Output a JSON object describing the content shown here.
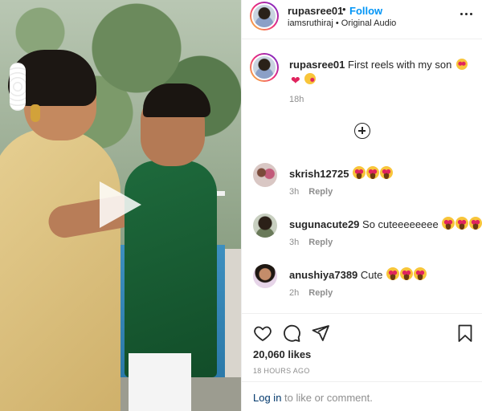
{
  "post": {
    "username": "rupasree01",
    "follow_label": "Follow",
    "separator": "•",
    "subtitle": "iamsruthiraj • Original Audio",
    "caption_text": "First reels with my son",
    "caption_time": "18h"
  },
  "comments": [
    {
      "username": "skrish12725",
      "text": "",
      "time": "3h",
      "reply_label": "Reply",
      "emoji_count": 3
    },
    {
      "username": "sugunacute29",
      "text": "So cuteeeeeeee",
      "time": "3h",
      "reply_label": "Reply",
      "emoji_count": 3
    },
    {
      "username": "anushiya7389",
      "text": "Cute",
      "time": "2h",
      "reply_label": "Reply",
      "emoji_count": 3
    }
  ],
  "footer": {
    "likes": "20,060 likes",
    "date": "18 HOURS AGO",
    "login_link": "Log in",
    "login_rest": " to like or comment."
  },
  "icons": {
    "like": "heart-outline-icon",
    "comment": "comment-bubble-icon",
    "share": "paper-plane-icon",
    "save": "bookmark-icon",
    "more": "more-dots-icon",
    "load_more": "add-circle-icon",
    "play": "play-icon"
  },
  "colors": {
    "follow_blue": "#0095f6",
    "link_dark_blue": "#00376b",
    "muted_gray": "#8e8e8e",
    "text_dark": "#262626"
  }
}
